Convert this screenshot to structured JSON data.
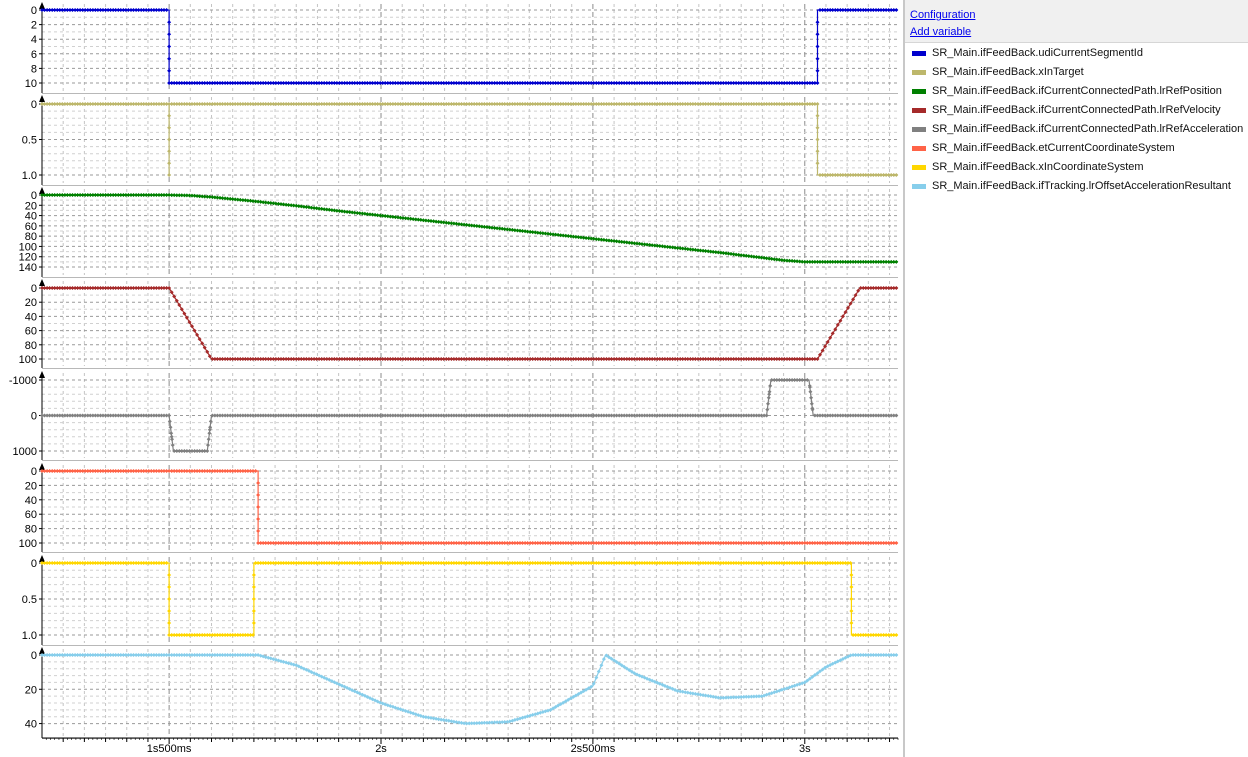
{
  "sidebar": {
    "configuration_label": "Configuration",
    "add_variable_label": "Add variable"
  },
  "legend": [
    {
      "label": "SR_Main.ifFeedBack.udiCurrentSegmentId",
      "color": "#0000cd"
    },
    {
      "label": "SR_Main.ifFeedBack.xInTarget",
      "color": "#bdb76b"
    },
    {
      "label": "SR_Main.ifFeedBack.ifCurrentConnectedPath.lrRefPosition",
      "color": "#008000"
    },
    {
      "label": "SR_Main.ifFeedBack.ifCurrentConnectedPath.lrRefVelocity",
      "color": "#a52a2a"
    },
    {
      "label": "SR_Main.ifFeedBack.ifCurrentConnectedPath.lrRefAcceleration",
      "color": "#808080"
    },
    {
      "label": "SR_Main.ifFeedBack.etCurrentCoordinateSystem",
      "color": "#ff6347"
    },
    {
      "label": "SR_Main.ifFeedBack.xInCoordinateSystem",
      "color": "#ffd700"
    },
    {
      "label": "SR_Main.ifFeedBack.ifTracking.lrOffsetAccelerationResultant",
      "color": "#87ceeb"
    }
  ],
  "time_axis": {
    "range_s": [
      1.2,
      3.22
    ],
    "tick_labels": [
      {
        "t": 1.5,
        "label": "1s500ms"
      },
      {
        "t": 2.0,
        "label": "2s"
      },
      {
        "t": 2.5,
        "label": "2s500ms"
      },
      {
        "t": 3.0,
        "label": "3s"
      }
    ]
  },
  "chart_data": [
    {
      "type": "line",
      "series": [
        {
          "name": "SR_Main.ifFeedBack.udiCurrentSegmentId",
          "color": "#0000cd",
          "step": true,
          "x": [
            1.2,
            1.5,
            1.5,
            3.03,
            3.03,
            3.22
          ],
          "y": [
            0,
            0,
            10,
            10,
            0,
            0
          ]
        }
      ],
      "ylim": [
        0,
        10
      ],
      "yticks": [
        0,
        2,
        4,
        6,
        8,
        10
      ],
      "yticklabels": [
        "0",
        "2",
        "4",
        "6",
        "8",
        "10"
      ]
    },
    {
      "type": "line",
      "series": [
        {
          "name": "SR_Main.ifFeedBack.xInTarget",
          "color": "#bdb76b",
          "step": true,
          "x": [
            1.2,
            1.5,
            1.5,
            1.5,
            1.5,
            3.03,
            3.03,
            3.22
          ],
          "y": [
            0,
            0,
            1,
            1,
            0,
            0,
            1,
            1
          ]
        }
      ],
      "ylim": [
        0,
        1.0
      ],
      "yticks": [
        0,
        0.5,
        1.0
      ],
      "yticklabels": [
        "0",
        "0.5",
        "1.0"
      ]
    },
    {
      "type": "line",
      "series": [
        {
          "name": "SR_Main.ifFeedBack.ifCurrentConnectedPath.lrRefPosition",
          "color": "#008000",
          "step": false,
          "x": [
            1.2,
            1.5,
            1.55,
            1.6,
            1.7,
            1.8,
            1.9,
            2.0,
            2.2,
            2.4,
            2.6,
            2.8,
            2.9,
            2.95,
            3.0,
            3.22
          ],
          "y": [
            0,
            0,
            1,
            4,
            12,
            21,
            31,
            40,
            58,
            76,
            94,
            112,
            122,
            127,
            130,
            130
          ]
        }
      ],
      "ylim": [
        0,
        140
      ],
      "yticks": [
        0,
        20,
        40,
        60,
        80,
        100,
        120,
        140
      ],
      "yticklabels": [
        "0",
        "20",
        "40",
        "60",
        "80",
        "100",
        "120",
        "140"
      ]
    },
    {
      "type": "line",
      "series": [
        {
          "name": "SR_Main.ifFeedBack.ifCurrentConnectedPath.lrRefVelocity",
          "color": "#a52a2a",
          "step": false,
          "x": [
            1.2,
            1.5,
            1.6,
            3.03,
            3.13,
            3.22
          ],
          "y": [
            0,
            0,
            100,
            100,
            0,
            0
          ]
        }
      ],
      "ylim": [
        0,
        100
      ],
      "yticks": [
        0,
        20,
        40,
        60,
        80,
        100
      ],
      "yticklabels": [
        "0",
        "20",
        "40",
        "60",
        "80",
        "100"
      ]
    },
    {
      "type": "line",
      "series": [
        {
          "name": "SR_Main.ifFeedBack.ifCurrentConnectedPath.lrRefAcceleration",
          "color": "#808080",
          "step": false,
          "x": [
            1.2,
            1.5,
            1.51,
            1.59,
            1.6,
            2.91,
            2.92,
            3.01,
            3.02,
            3.22
          ],
          "y": [
            0,
            0,
            1000,
            1000,
            0,
            0,
            -1000,
            -1000,
            0,
            0
          ]
        }
      ],
      "ylim": [
        -1000,
        1000
      ],
      "yticks": [
        -1000,
        0,
        1000
      ],
      "yticklabels": [
        "-1000",
        "0",
        "1000"
      ],
      "band": true
    },
    {
      "type": "line",
      "series": [
        {
          "name": "SR_Main.ifFeedBack.etCurrentCoordinateSystem",
          "color": "#ff6347",
          "step": true,
          "x": [
            1.2,
            1.71,
            1.71,
            3.22
          ],
          "y": [
            0,
            0,
            100,
            100
          ]
        }
      ],
      "ylim": [
        0,
        100
      ],
      "yticks": [
        0,
        20,
        40,
        60,
        80,
        100
      ],
      "yticklabels": [
        "0",
        "20",
        "40",
        "60",
        "80",
        "100"
      ]
    },
    {
      "type": "line",
      "series": [
        {
          "name": "SR_Main.ifFeedBack.xInCoordinateSystem",
          "color": "#ffd700",
          "step": true,
          "x": [
            1.2,
            1.5,
            1.5,
            1.7,
            1.7,
            3.11,
            3.11,
            3.22
          ],
          "y": [
            0,
            0,
            1,
            1,
            0,
            0,
            1,
            1
          ]
        }
      ],
      "ylim": [
        0,
        1.0
      ],
      "yticks": [
        0,
        0.5,
        1.0
      ],
      "yticklabels": [
        "0",
        "0.5",
        "1.0"
      ]
    },
    {
      "type": "line",
      "series": [
        {
          "name": "SR_Main.ifFeedBack.ifTracking.lrOffsetAccelerationResultant",
          "color": "#87ceeb",
          "step": false,
          "x": [
            1.2,
            1.5,
            1.71,
            1.8,
            1.9,
            2.0,
            2.1,
            2.2,
            2.3,
            2.4,
            2.5,
            2.53,
            2.6,
            2.7,
            2.8,
            2.9,
            3.0,
            3.05,
            3.11,
            3.22
          ],
          "y": [
            0,
            0,
            0,
            6,
            17,
            28,
            36,
            40,
            39,
            32,
            18,
            0,
            11,
            21,
            25,
            24,
            16,
            7,
            0,
            0
          ]
        }
      ],
      "ylim": [
        0,
        42
      ],
      "yticks": [
        0,
        20,
        40
      ],
      "yticklabels": [
        "0",
        "20",
        "40"
      ]
    }
  ]
}
